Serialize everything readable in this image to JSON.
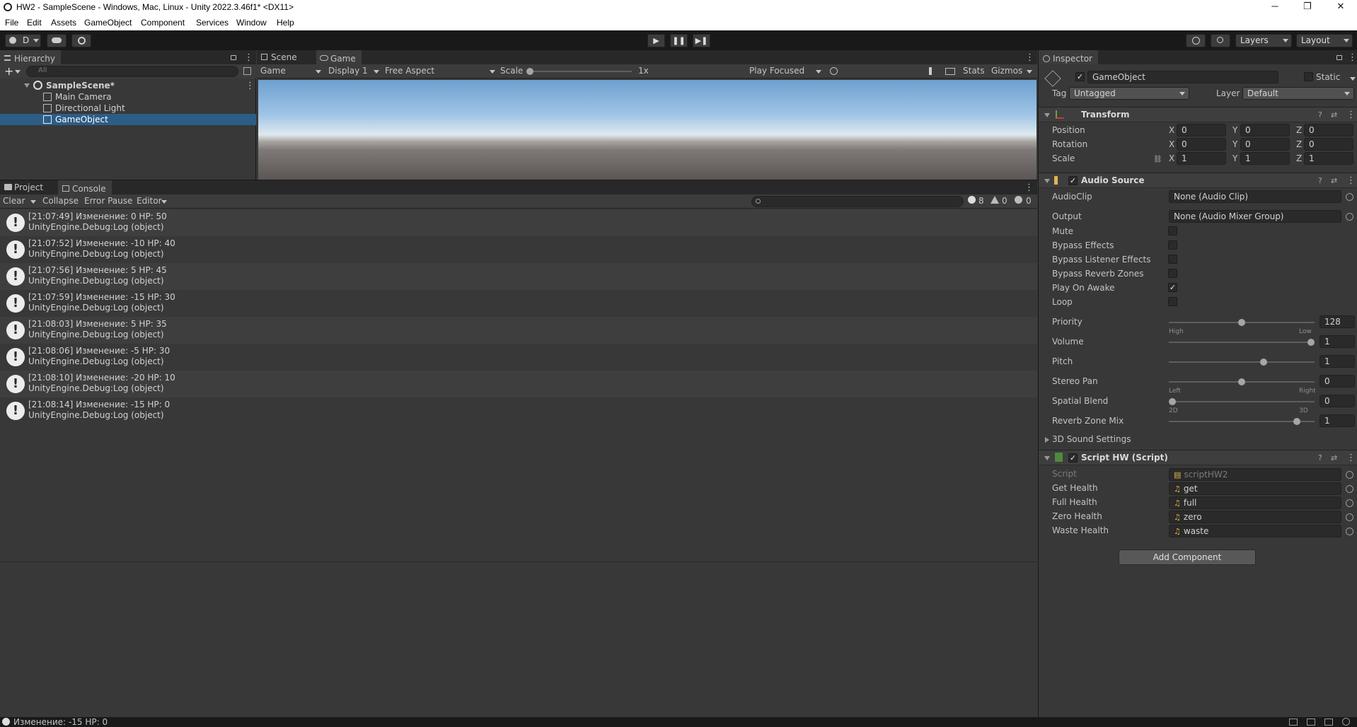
{
  "window": {
    "title": "HW2 - SampleScene - Windows, Mac, Linux - Unity 2022.3.46f1* <DX11>",
    "controls": [
      "─",
      "❐",
      "✕"
    ]
  },
  "menu": [
    "File",
    "Edit",
    "Assets",
    "GameObject",
    "Component",
    "Services",
    "Window",
    "Help"
  ],
  "toolbar": {
    "account_label": "D",
    "layers_label": "Layers",
    "layout_label": "Layout",
    "play": "▶",
    "pause": "❚❚",
    "step": "▶❚"
  },
  "hierarchy": {
    "tab": "Hierarchy",
    "search_placeholder": "All",
    "add": "+",
    "scene": "SampleScene*",
    "items": [
      "Main Camera",
      "Directional Light",
      "GameObject"
    ]
  },
  "gameview": {
    "tabs": [
      "Scene",
      "Game"
    ],
    "mode": "Game",
    "display": "Display 1",
    "aspect": "Free Aspect",
    "scale_label": "Scale",
    "scale_value": "1x",
    "play_mode": "Play Focused",
    "stats": "Stats",
    "gizmos": "Gizmos"
  },
  "console": {
    "tabs": [
      "Project",
      "Console"
    ],
    "toolbar": [
      "Clear",
      "Collapse",
      "Error Pause",
      "Editor"
    ],
    "counts": {
      "log": "8",
      "warn": "0",
      "error": "0"
    },
    "entries": [
      {
        "line1": "[21:07:49] Изменение: 0 HP: 50",
        "line2": "UnityEngine.Debug:Log (object)"
      },
      {
        "line1": "[21:07:52] Изменение: -10 HP: 40",
        "line2": "UnityEngine.Debug:Log (object)"
      },
      {
        "line1": "[21:07:56] Изменение: 5 HP: 45",
        "line2": "UnityEngine.Debug:Log (object)"
      },
      {
        "line1": "[21:07:59] Изменение: -15 HP: 30",
        "line2": "UnityEngine.Debug:Log (object)"
      },
      {
        "line1": "[21:08:03] Изменение: 5 HP: 35",
        "line2": "UnityEngine.Debug:Log (object)"
      },
      {
        "line1": "[21:08:06] Изменение: -5 HP: 30",
        "line2": "UnityEngine.Debug:Log (object)"
      },
      {
        "line1": "[21:08:10] Изменение: -20 HP: 10",
        "line2": "UnityEngine.Debug:Log (object)"
      },
      {
        "line1": "[21:08:14] Изменение: -15 HP: 0",
        "line2": "UnityEngine.Debug:Log (object)"
      }
    ]
  },
  "inspector": {
    "tab": "Inspector",
    "object_name": "GameObject",
    "static_label": "Static",
    "tag_label": "Tag",
    "tag_value": "Untagged",
    "layer_label": "Layer",
    "layer_value": "Default",
    "transform": {
      "title": "Transform",
      "rows": [
        {
          "label": "Position",
          "x": "0",
          "y": "0",
          "z": "0"
        },
        {
          "label": "Rotation",
          "x": "0",
          "y": "0",
          "z": "0"
        },
        {
          "label": "Scale",
          "x": "1",
          "y": "1",
          "z": "1"
        }
      ]
    },
    "audio": {
      "title": "Audio Source",
      "audioclip_label": "AudioClip",
      "audioclip_value": "None (Audio Clip)",
      "output_label": "Output",
      "output_value": "None (Audio Mixer Group)",
      "toggles": [
        {
          "label": "Mute",
          "checked": false
        },
        {
          "label": "Bypass Effects",
          "checked": false
        },
        {
          "label": "Bypass Listener Effects",
          "checked": false
        },
        {
          "label": "Bypass Reverb Zones",
          "checked": false
        },
        {
          "label": "Play On Awake",
          "checked": true
        },
        {
          "label": "Loop",
          "checked": false
        }
      ],
      "sliders": [
        {
          "label": "Priority",
          "value": "128",
          "fraction": 0.5,
          "left": "High",
          "right": "Low"
        },
        {
          "label": "Volume",
          "value": "1",
          "fraction": 1.0,
          "left": "",
          "right": ""
        },
        {
          "label": "Pitch",
          "value": "1",
          "fraction": 0.66,
          "left": "",
          "right": ""
        },
        {
          "label": "Stereo Pan",
          "value": "0",
          "fraction": 0.5,
          "left": "Left",
          "right": "Right"
        },
        {
          "label": "Spatial Blend",
          "value": "0",
          "fraction": 0.0,
          "left": "2D",
          "right": "3D"
        },
        {
          "label": "Reverb Zone Mix",
          "value": "1",
          "fraction": 0.9,
          "left": "",
          "right": ""
        }
      ],
      "sound_settings": "3D Sound Settings"
    },
    "script": {
      "title": "Script HW (Script)",
      "rows": [
        {
          "label": "Script",
          "value": "scriptHW2"
        },
        {
          "label": "Get Health",
          "value": "get"
        },
        {
          "label": "Full Health",
          "value": "full"
        },
        {
          "label": "Zero Health",
          "value": "zero"
        },
        {
          "label": "Waste Health",
          "value": "waste"
        }
      ]
    },
    "add_component": "Add Component"
  },
  "status": {
    "message": "Изменение: -15 HP: 0"
  },
  "colors": {
    "selection": "#2c5d87",
    "bg": "#383838",
    "toolbar": "#191919"
  }
}
